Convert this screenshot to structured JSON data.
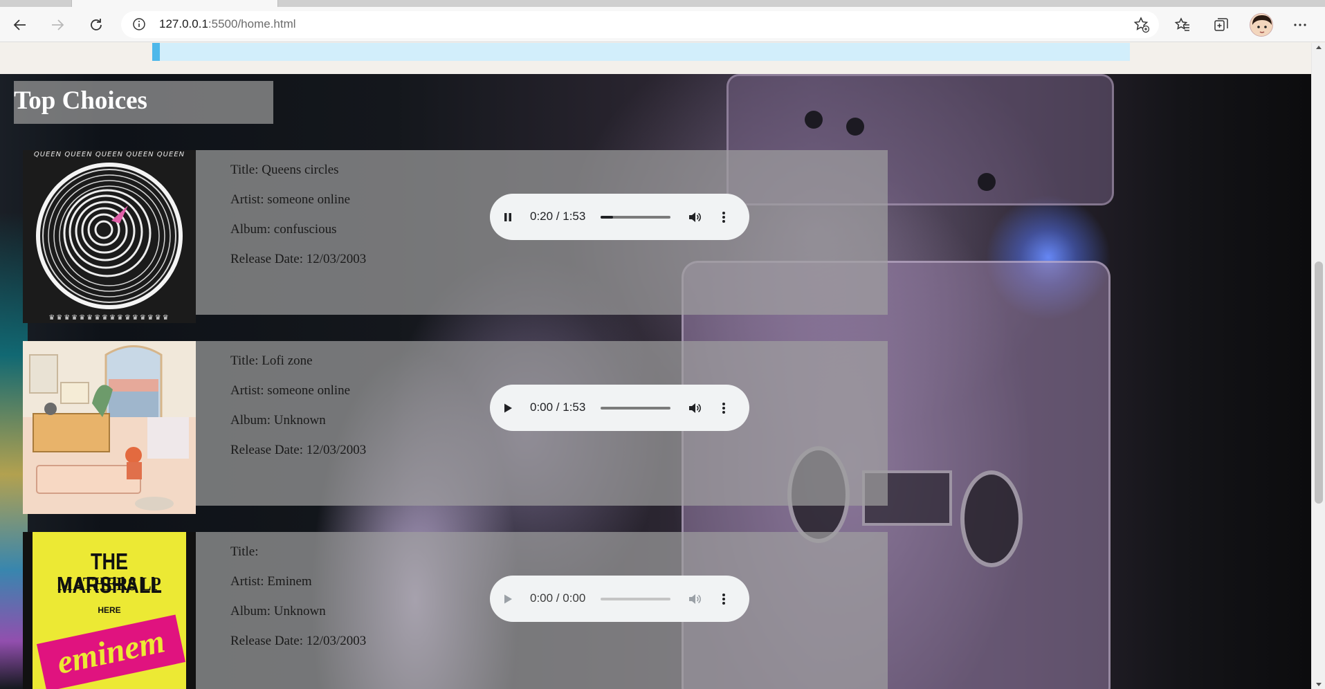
{
  "browser": {
    "url_host": "127.0.0.1",
    "url_rest": ":5500/home.html",
    "icons": [
      "back-icon",
      "forward-icon",
      "refresh-icon",
      "site-info-icon",
      "add-favorite-icon",
      "favorites-icon",
      "collections-icon",
      "profile-avatar",
      "more-menu-icon"
    ]
  },
  "section": {
    "title": "Top Choices"
  },
  "songs": [
    {
      "title": "Title: Queens circles",
      "artist": "Artist: someone online",
      "album": "Album: confuscious",
      "release": "Release Date: 12/03/2003",
      "cover_text_top": "QUEEN QUEEN QUEEN QUEEN QUEEN",
      "player": {
        "state": "playing",
        "time": "0:20 / 1:53",
        "progress": 0.177
      }
    },
    {
      "title": "Title: Lofi zone",
      "artist": "Artist: someone online",
      "album": "Album: Unknown",
      "release": "Release Date: 12/03/2003",
      "player": {
        "state": "paused",
        "time": "0:00 / 1:53",
        "progress": 0
      }
    },
    {
      "title": "Title:",
      "artist": "Artist: Eminem",
      "album": "Album: Unknown",
      "release": "Release Date: 12/03/2003",
      "cover_line1": "THE MARSHALL",
      "cover_line2": "MATHERS LP",
      "cover_line3": "HERE",
      "cover_stamp": "eminem",
      "player": {
        "state": "disabled",
        "time": "0:00 / 0:00",
        "progress": 0
      }
    }
  ],
  "colors": {
    "panel": "#a0a0a0",
    "player_bg": "#f1f3f4",
    "accent_blue": "#4eb8ea"
  }
}
